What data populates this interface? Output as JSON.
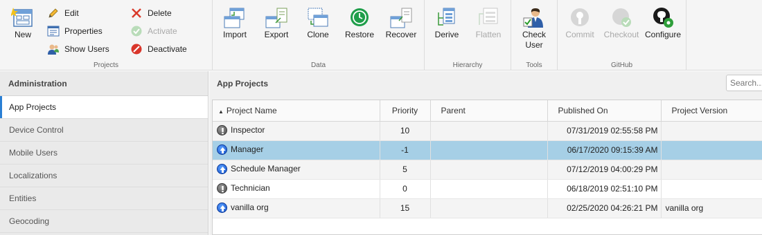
{
  "ribbon": {
    "groups": {
      "projects": "Projects",
      "data": "Data",
      "hierarchy": "Hierarchy",
      "tools": "Tools",
      "github": "GitHub"
    },
    "new": "New",
    "edit": "Edit",
    "properties": "Properties",
    "show_users": "Show Users",
    "delete": "Delete",
    "activate": "Activate",
    "deactivate": "Deactivate",
    "import": "Import",
    "export": "Export",
    "clone": "Clone",
    "restore": "Restore",
    "recover": "Recover",
    "derive": "Derive",
    "flatten": "Flatten",
    "check_user_line1": "Check",
    "check_user_line2": "User",
    "commit": "Commit",
    "checkout": "Checkout",
    "configure": "Configure"
  },
  "sidebar": {
    "header": "Administration",
    "items": [
      "App Projects",
      "Device Control",
      "Mobile Users",
      "Localizations",
      "Entities",
      "Geocoding"
    ]
  },
  "main": {
    "title": "App Projects",
    "search_placeholder": "Search..."
  },
  "table": {
    "columns": [
      "Project Name",
      "Priority",
      "Parent",
      "Published On",
      "Project Version"
    ],
    "rows": [
      {
        "icon": "gray-exclamation-icon",
        "name": "Inspector",
        "priority": "10",
        "parent": "",
        "published": "07/31/2019 02:55:58 PM",
        "version": ""
      },
      {
        "icon": "blue-up-arrow-icon",
        "name": "Manager",
        "priority": "-1",
        "parent": "",
        "published": "06/17/2020 09:15:39 AM",
        "version": ""
      },
      {
        "icon": "blue-up-arrow-icon",
        "name": "Schedule Manager",
        "priority": "5",
        "parent": "",
        "published": "07/12/2019 04:00:29 PM",
        "version": ""
      },
      {
        "icon": "gray-exclamation-icon",
        "name": "Technician",
        "priority": "0",
        "parent": "",
        "published": "06/18/2019 02:51:10 PM",
        "version": ""
      },
      {
        "icon": "blue-up-arrow-icon",
        "name": "vanilla org",
        "priority": "15",
        "parent": "",
        "published": "02/25/2020 04:26:21 PM",
        "version": "vanilla org"
      }
    ],
    "selected_row": 1
  },
  "colors": {
    "selection": "#a6cfe6",
    "accent": "#2a7fd4"
  }
}
